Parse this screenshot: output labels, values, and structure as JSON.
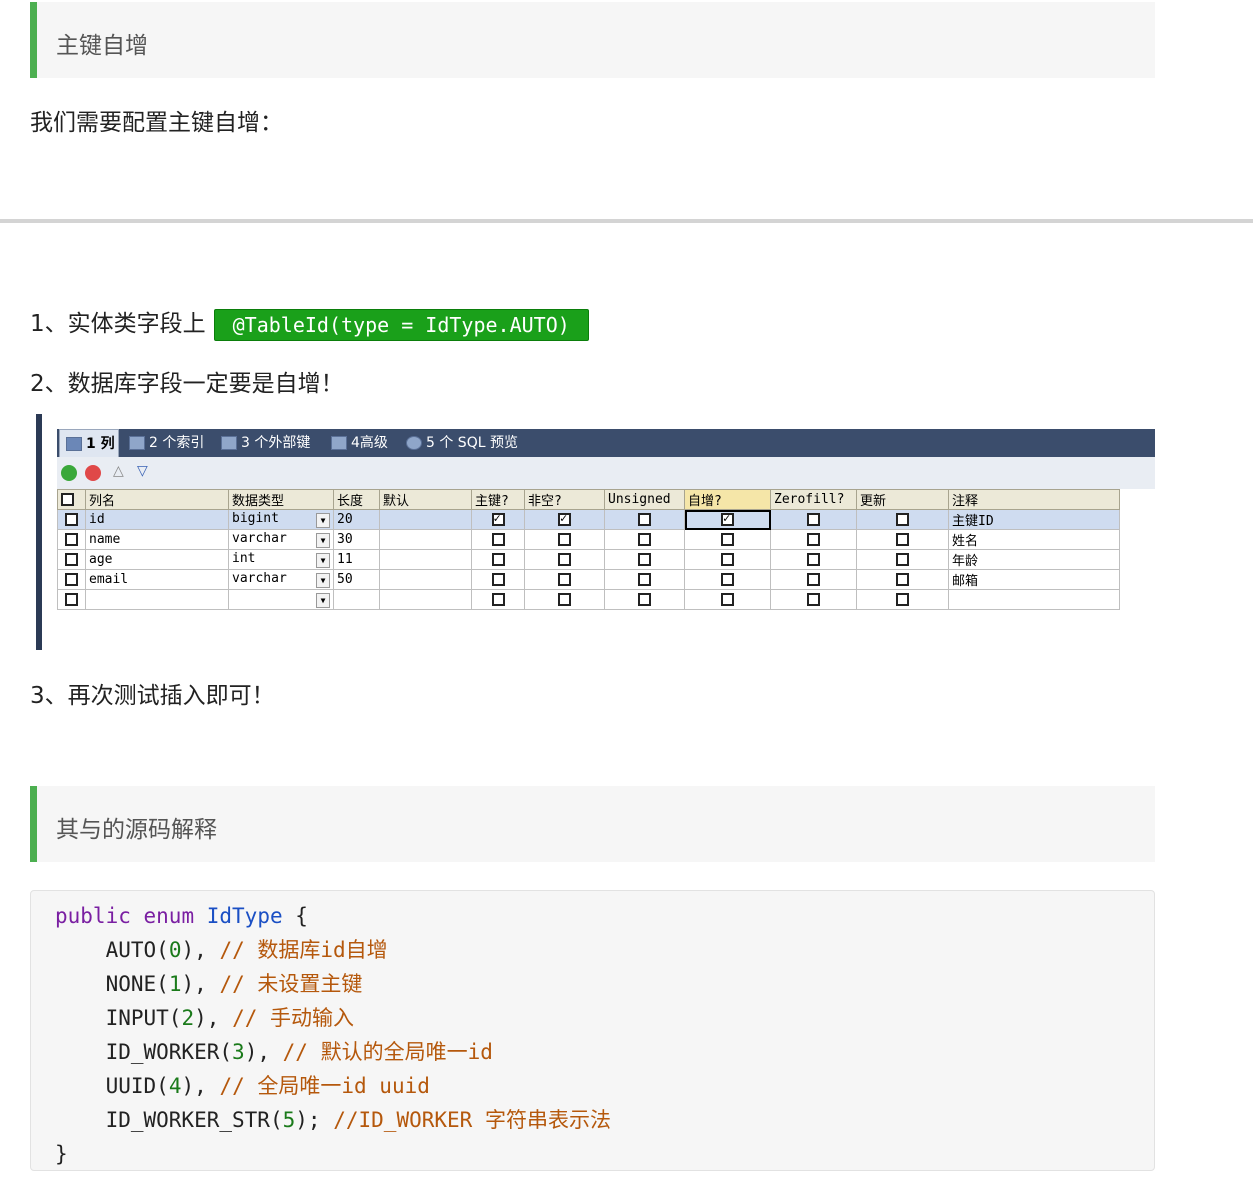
{
  "callout1": {
    "text": "主键自增"
  },
  "intro": "我们需要配置主键自增：",
  "steps": {
    "step1_prefix": "1、实体类字段上",
    "step1_code": "@TableId(type = IdType.AUTO)",
    "step2": "2、数据库字段一定要是自增！",
    "step3": "3、再次测试插入即可！"
  },
  "tabs": [
    {
      "label": "1 列",
      "active": true
    },
    {
      "label": "2 个索引",
      "active": false
    },
    {
      "label": "3 个外部键",
      "active": false
    },
    {
      "label": "4高级",
      "active": false
    },
    {
      "label": "5 个 SQL 预览",
      "active": false
    }
  ],
  "table": {
    "headers": [
      "列名",
      "数据类型",
      "长度",
      "默认",
      "主键?",
      "非空?",
      "Unsigned",
      "自增?",
      "Zerofill?",
      "更新",
      "注释"
    ],
    "rows": [
      {
        "name": "id",
        "type": "bigint",
        "length": "20",
        "default": "",
        "pk": true,
        "notnull": true,
        "unsigned": false,
        "ai": true,
        "zerofill": false,
        "update": false,
        "comment": "主键ID"
      },
      {
        "name": "name",
        "type": "varchar",
        "length": "30",
        "default": "",
        "pk": false,
        "notnull": false,
        "unsigned": false,
        "ai": false,
        "zerofill": false,
        "update": false,
        "comment": "姓名"
      },
      {
        "name": "age",
        "type": "int",
        "length": "11",
        "default": "",
        "pk": false,
        "notnull": false,
        "unsigned": false,
        "ai": false,
        "zerofill": false,
        "update": false,
        "comment": "年龄"
      },
      {
        "name": "email",
        "type": "varchar",
        "length": "50",
        "default": "",
        "pk": false,
        "notnull": false,
        "unsigned": false,
        "ai": false,
        "zerofill": false,
        "update": false,
        "comment": "邮箱"
      },
      {
        "name": "",
        "type": "",
        "length": "",
        "default": "",
        "pk": false,
        "notnull": false,
        "unsigned": false,
        "ai": false,
        "zerofill": false,
        "update": false,
        "comment": ""
      }
    ]
  },
  "callout2": {
    "text": "其与的源码解释"
  },
  "code": {
    "line1_kw1": "public",
    "line1_kw2": "enum",
    "line1_type": "IdType",
    "line1_brace": "{",
    "lines": [
      {
        "name": "AUTO",
        "num": "0",
        "sep": ",",
        "comment": "// 数据库id自增"
      },
      {
        "name": "NONE",
        "num": "1",
        "sep": ",",
        "comment": "// 未设置主键"
      },
      {
        "name": "INPUT",
        "num": "2",
        "sep": ",",
        "comment": "// 手动输入"
      },
      {
        "name": "ID_WORKER",
        "num": "3",
        "sep": ",",
        "comment": "// 默认的全局唯一id"
      },
      {
        "name": "UUID",
        "num": "4",
        "sep": ",",
        "comment": "// 全局唯一id uuid"
      },
      {
        "name": "ID_WORKER_STR",
        "num": "5",
        "sep": ";",
        "comment": "//ID_WORKER 字符串表示法"
      }
    ],
    "close": "}"
  }
}
